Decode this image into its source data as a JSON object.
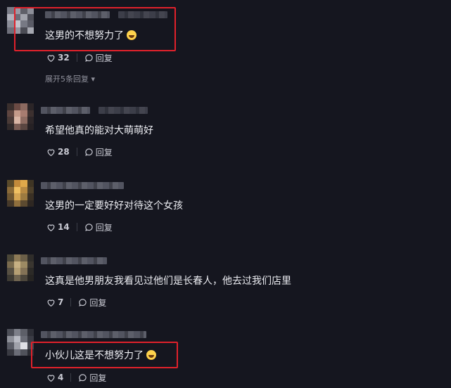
{
  "comments": [
    {
      "text": "这男的不想努力了",
      "emoji": "grinning-sweat-emoji",
      "likes": "32",
      "reply_label": "回复",
      "expand_label": "展开5条回复",
      "highlighted": true
    },
    {
      "text": "希望他真的能对大萌萌好",
      "likes": "28",
      "reply_label": "回复"
    },
    {
      "text": "这男的一定要好好对待这个女孩",
      "likes": "14",
      "reply_label": "回复"
    },
    {
      "text": "这真是他男朋友我看见过他们是长春人，他去过我们店里",
      "likes": "7",
      "reply_label": "回复"
    },
    {
      "text": "小伙儿这是不想努力了",
      "emoji": "rofl-emoji",
      "likes": "4",
      "reply_label": "回复",
      "highlighted": true
    }
  ],
  "colors": {
    "background": "#15161f",
    "highlight_border": "#e1212b",
    "text": "#ecedf2",
    "muted": "#8f909b"
  }
}
